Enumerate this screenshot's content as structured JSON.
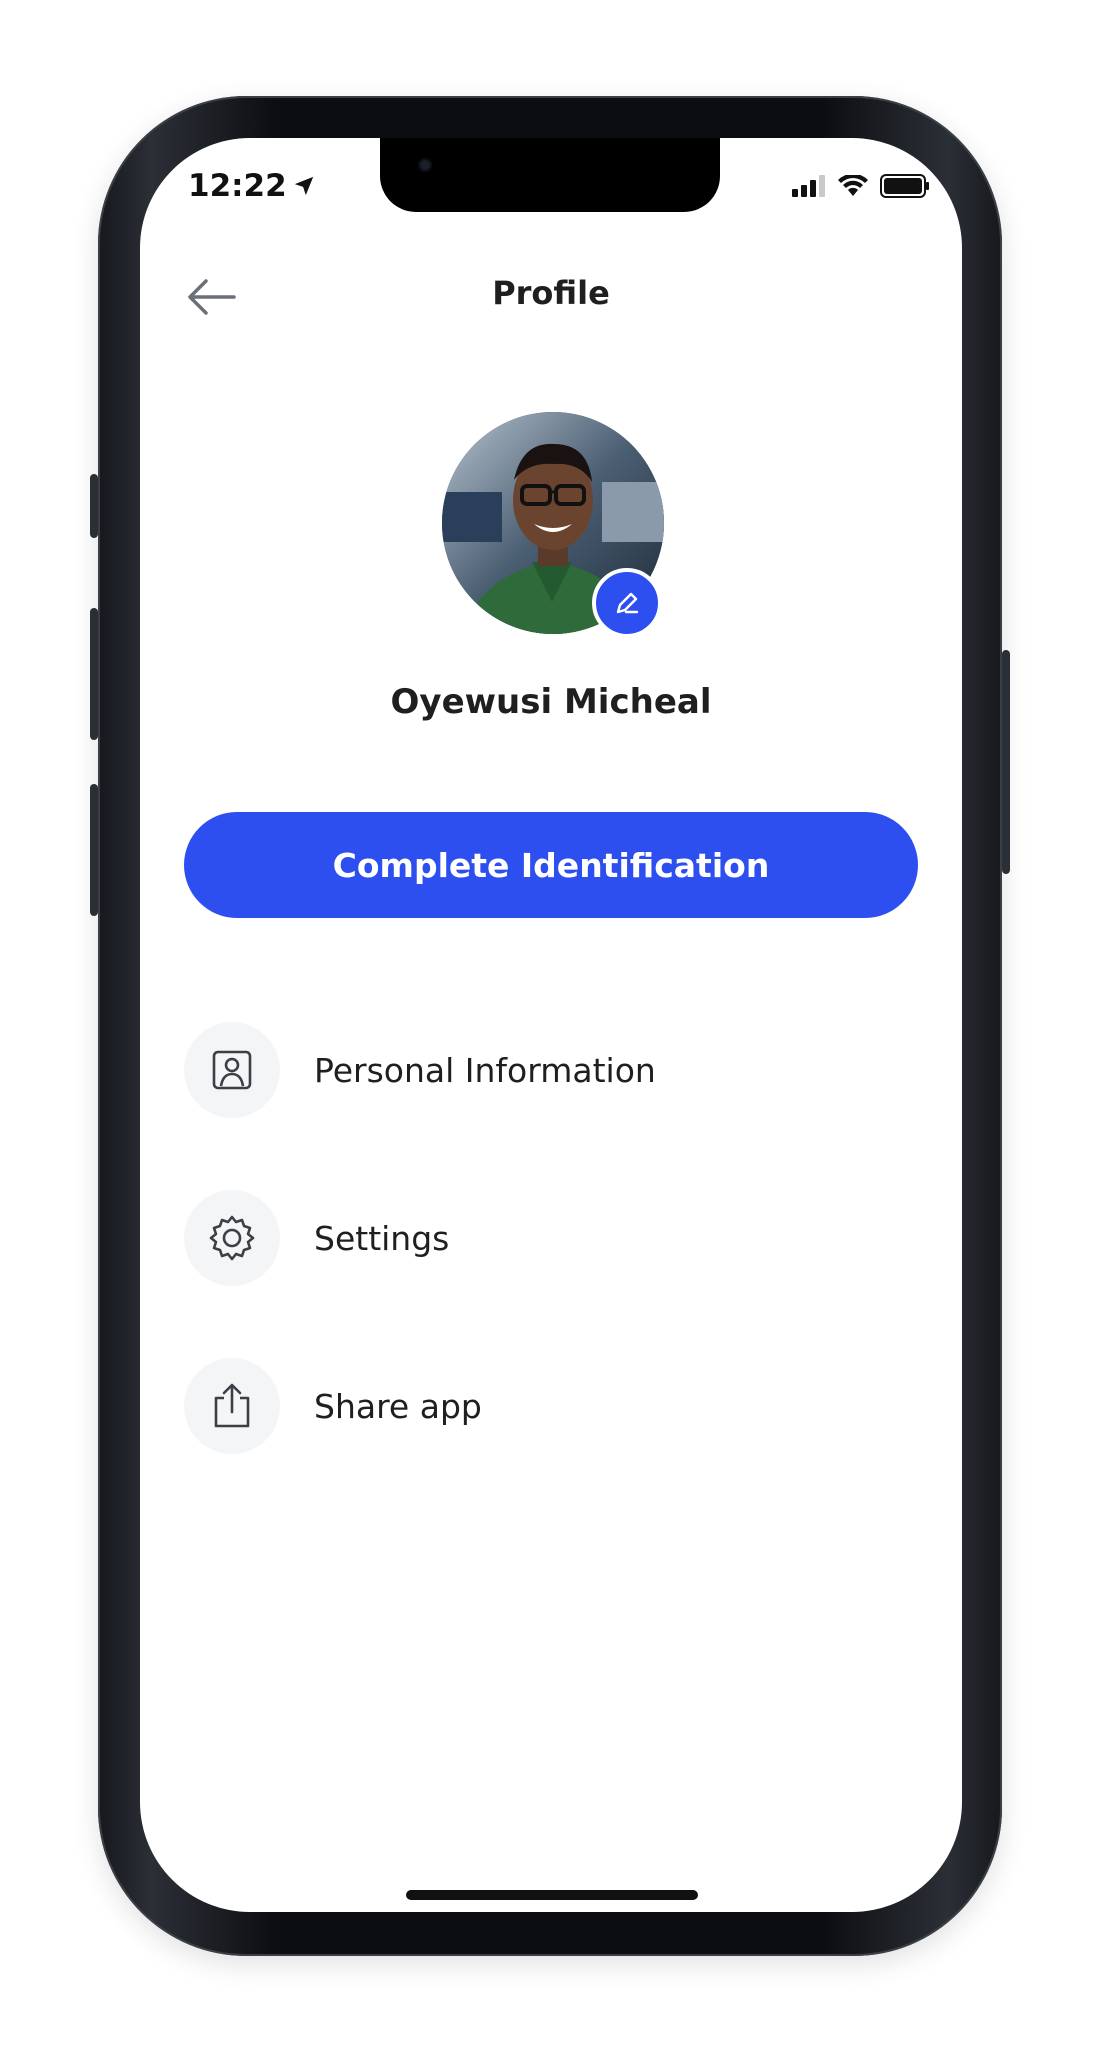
{
  "status_bar": {
    "time": "12:22"
  },
  "header": {
    "title": "Profile"
  },
  "profile": {
    "name": "Oyewusi Micheal"
  },
  "primary_action": {
    "label": "Complete Identification"
  },
  "menu": [
    {
      "label": "Personal Information",
      "icon": "person-frame-icon"
    },
    {
      "label": "Settings",
      "icon": "gear-icon"
    },
    {
      "label": "Share app",
      "icon": "share-icon"
    }
  ],
  "colors": {
    "accent": "#2d4ff0",
    "icon_bg": "#f3f5f6",
    "text": "#1f1f1f"
  }
}
